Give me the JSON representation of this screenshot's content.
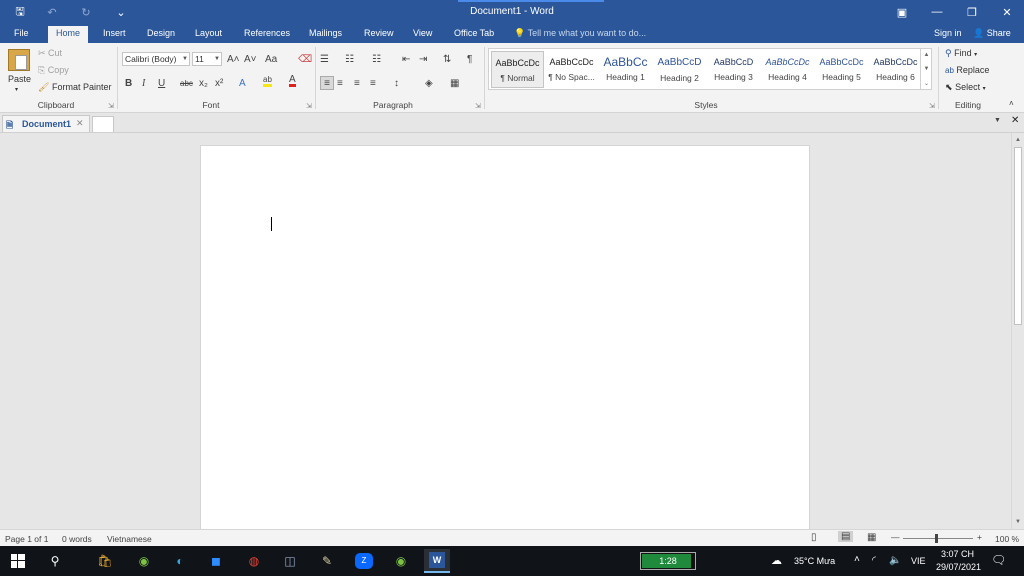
{
  "window": {
    "title": "Document1 - Word",
    "controls": {
      "ribbon_display": "▣",
      "minimize": "—",
      "restore": "❐",
      "close": "✕"
    },
    "quick_access": {
      "save": "🖫",
      "undo": "↶",
      "redo": "↻",
      "customize": "⌄"
    }
  },
  "tabs": [
    {
      "label": "File"
    },
    {
      "label": "Home"
    },
    {
      "label": "Insert"
    },
    {
      "label": "Design"
    },
    {
      "label": "Layout"
    },
    {
      "label": "References"
    },
    {
      "label": "Mailings"
    },
    {
      "label": "Review"
    },
    {
      "label": "View"
    },
    {
      "label": "Office Tab"
    }
  ],
  "tell_me": {
    "icon": "💡",
    "placeholder": "Tell me what you want to do..."
  },
  "account": {
    "sign_in": "Sign in",
    "share": "Share",
    "share_icon": "👤"
  },
  "clipboard": {
    "group_label": "Clipboard",
    "paste": "Paste",
    "cut": "Cut",
    "copy": "Copy",
    "format_painter": "Format Painter"
  },
  "font": {
    "group_label": "Font",
    "name": "Calibri (Body)",
    "size": "11",
    "grow": "A˄",
    "shrink": "A˅",
    "change_case": "Aa",
    "clear": "⌫",
    "bold": "B",
    "italic": "I",
    "underline": "U",
    "strike": "abc",
    "subscript": "x₂",
    "superscript": "x²",
    "text_effects": "A",
    "highlight": "ab",
    "font_color": "A"
  },
  "paragraph": {
    "group_label": "Paragraph",
    "bullets": "☰",
    "numbering": "☷",
    "multilevel": "☷",
    "decrease_indent": "⇤",
    "increase_indent": "⇥",
    "sort": "⇅",
    "show_marks": "¶",
    "align_left": "≡",
    "align_center": "≡",
    "align_right": "≡",
    "justify": "≡",
    "line_spacing": "↕",
    "shading": "◈",
    "borders": "▦"
  },
  "styles": {
    "group_label": "Styles",
    "items": [
      {
        "preview": "AaBbCcDc",
        "name": "¶ Normal"
      },
      {
        "preview": "AaBbCcDc",
        "name": "¶ No Spac..."
      },
      {
        "preview": "AaBbCc",
        "name": "Heading 1"
      },
      {
        "preview": "AaBbCcD",
        "name": "Heading 2"
      },
      {
        "preview": "AaBbCcD",
        "name": "Heading 3"
      },
      {
        "preview": "AaBbCcDc",
        "name": "Heading 4"
      },
      {
        "preview": "AaBbCcDc",
        "name": "Heading 5"
      },
      {
        "preview": "AaBbCcDc",
        "name": "Heading 6"
      }
    ]
  },
  "editing": {
    "group_label": "Editing",
    "find": "Find",
    "replace": "Replace",
    "select": "Select"
  },
  "doc_tabs": [
    {
      "label": "Document1"
    }
  ],
  "status": {
    "page": "Page 1 of 1",
    "words": "0 words",
    "language": "Vietnamese",
    "zoom": "100 %"
  },
  "taskbar": {
    "timer": "1:28",
    "timer_progress": 0.9,
    "weather": "35°C Mưa",
    "language": "VIE",
    "time": "3:07 CH",
    "date": "29/07/2021",
    "apps": [
      {
        "name": "search-icon",
        "glyph": "⚲"
      },
      {
        "name": "store-icon",
        "glyph": "🛍"
      },
      {
        "name": "app-green-icon",
        "glyph": "◉"
      },
      {
        "name": "edge-icon",
        "glyph": "◐"
      },
      {
        "name": "zoom-icon",
        "glyph": "◼"
      },
      {
        "name": "chrome-icon",
        "glyph": "◍"
      },
      {
        "name": "camera-icon",
        "glyph": "◫"
      },
      {
        "name": "tool-icon",
        "glyph": "✎"
      },
      {
        "name": "zalo-icon",
        "glyph": "Z"
      },
      {
        "name": "app-green2-icon",
        "glyph": "◉"
      },
      {
        "name": "word-icon",
        "glyph": "W"
      }
    ]
  },
  "colors": {
    "word_blue": "#2b579a",
    "taskbar": "#101318",
    "battery_green": "#1f8a3c"
  }
}
